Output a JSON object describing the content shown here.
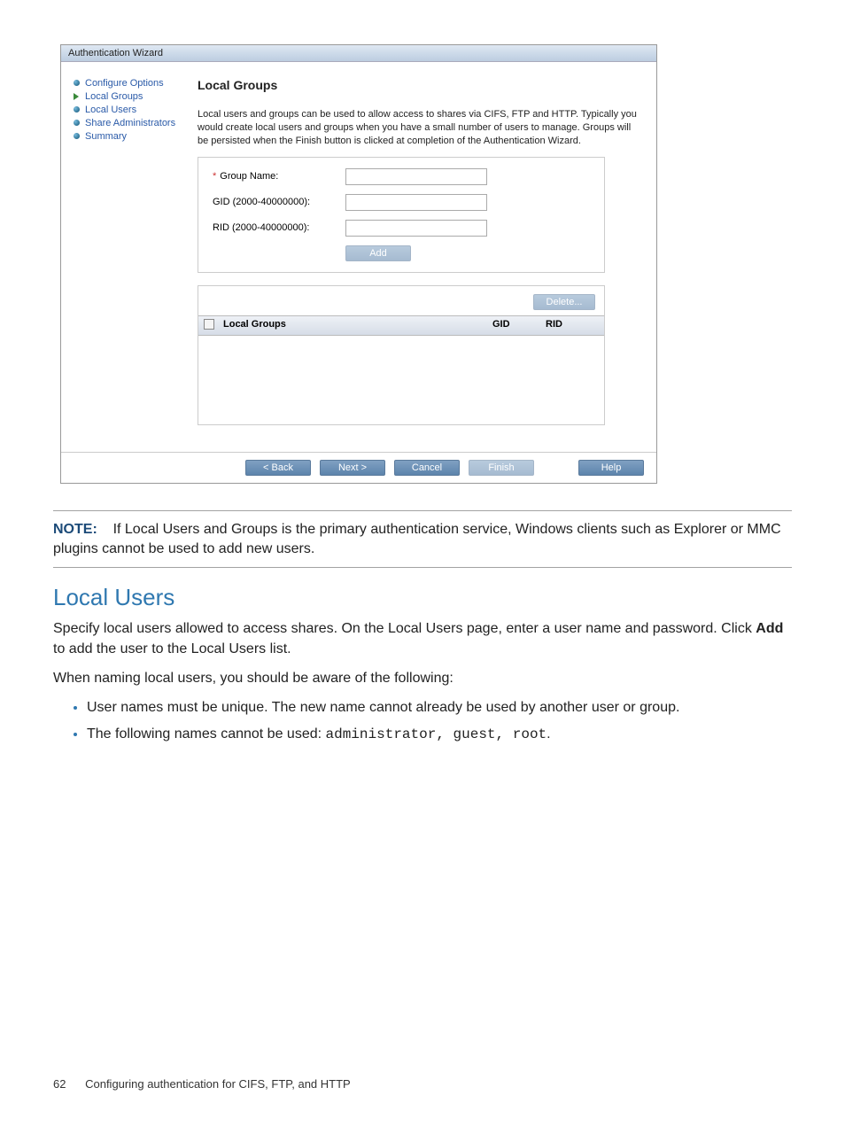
{
  "wizard": {
    "title": "Authentication Wizard",
    "sidebar": [
      {
        "label": "Configure Options",
        "active": false
      },
      {
        "label": "Local Groups",
        "active": true
      },
      {
        "label": "Local Users",
        "active": false
      },
      {
        "label": "Share Administrators",
        "active": false
      },
      {
        "label": "Summary",
        "active": false
      }
    ],
    "heading": "Local Groups",
    "intro": "Local users and groups can be used to allow access to shares via CIFS, FTP and HTTP. Typically you would create local users and groups when you have a small number of users to manage. Groups will be persisted when the Finish button is clicked at completion of the Authentication Wizard.",
    "form": {
      "group_name_label": "Group Name:",
      "gid_label": "GID (2000-40000000):",
      "rid_label": "RID (2000-40000000):",
      "add_button": "Add"
    },
    "table": {
      "delete_button": "Delete...",
      "col_groups": "Local Groups",
      "col_gid": "GID",
      "col_rid": "RID"
    },
    "footer": {
      "back": "< Back",
      "next": "Next >",
      "cancel": "Cancel",
      "finish": "Finish",
      "help": "Help"
    }
  },
  "doc": {
    "note_label": "NOTE:",
    "note_text": "If Local Users and Groups is the primary authentication service, Windows clients such as Explorer or MMC plugins cannot be used to add new users.",
    "section_heading": "Local Users",
    "p1a": "Specify local users allowed to access shares. On the Local Users page, enter a user name and password. Click ",
    "p1_bold": "Add",
    "p1b": " to add the user to the Local Users list.",
    "p2": "When naming local users, you should be aware of the following:",
    "bullets": {
      "b1": "User names must be unique. The new name cannot already be used by another user or group.",
      "b2a": "The following names cannot be used: ",
      "b2_code": "administrator, guest, root",
      "b2b": "."
    }
  },
  "page_footer": {
    "number": "62",
    "text": "Configuring authentication for CIFS, FTP, and HTTP"
  }
}
